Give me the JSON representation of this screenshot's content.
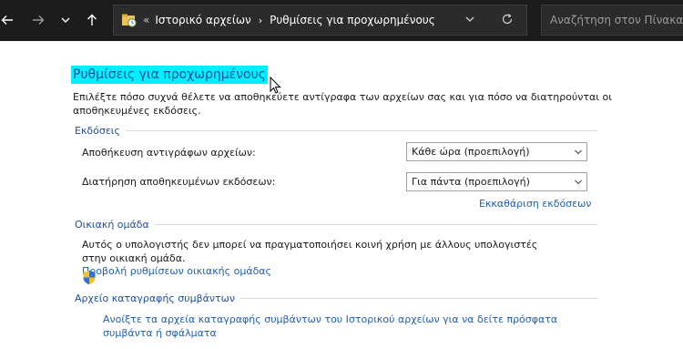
{
  "nav": {
    "back_icon": "arrow-left-icon",
    "forward_icon": "arrow-right-icon",
    "recent_icon": "chevron-down-icon",
    "up_icon": "arrow-up-icon"
  },
  "address_bar": {
    "overflow": "«",
    "crumbs": [
      "Ιστορικό αρχείων",
      "Ρυθμίσεις για προχωρημένους"
    ],
    "separator": "›",
    "dropdown_icon": "chevron-down-icon",
    "refresh_icon": "refresh-icon"
  },
  "search": {
    "placeholder": "Αναζήτηση στον Πίνακα Ελέγχου",
    "value": ""
  },
  "page": {
    "title": "Ρυθμίσεις για προχωρημένους",
    "description": "Επιλέξτε πόσο συχνά θέλετε να αποθηκεύετε αντίγραφα των αρχείων σας και για πόσο να διατηρούνται οι αποθηκευμένες εκδόσεις."
  },
  "versions": {
    "header": "Εκδόσεις",
    "save_label": "Αποθήκευση αντιγράφων αρχείων:",
    "save_value": "Κάθε ώρα (προεπιλογή)",
    "keep_label": "Διατήρηση αποθηκευμένων εκδόσεων:",
    "keep_value": "Για πάντα (προεπιλογή)",
    "cleanup_link": "Εκκαθάριση εκδόσεων"
  },
  "homegroup": {
    "header": "Οικιακή ομάδα",
    "text": "Αυτός ο υπολογιστής δεν μπορεί να πραγματοποιήσει κοινή χρήση με άλλους υπολογιστές στην οικιακή ομάδα.",
    "link": "Προβολή ρυθμίσεων οικιακής ομάδας"
  },
  "eventlog": {
    "header": "Αρχείο καταγραφής συμβάντων",
    "link_line1": "Ανοίξτε τα αρχεία καταγραφής συμβάντων του Ιστορικού αρχείων για να δείτε πρόσφατα",
    "link_line2": "συμβάντα ή σφάλματα",
    "shield_icon": "uac-shield-icon"
  },
  "colors": {
    "titlebar_bg": "#1c1c1c",
    "title_highlight": "#00f0ff",
    "header_blue": "#1f4e9a",
    "link_blue": "#1f5fb0"
  }
}
